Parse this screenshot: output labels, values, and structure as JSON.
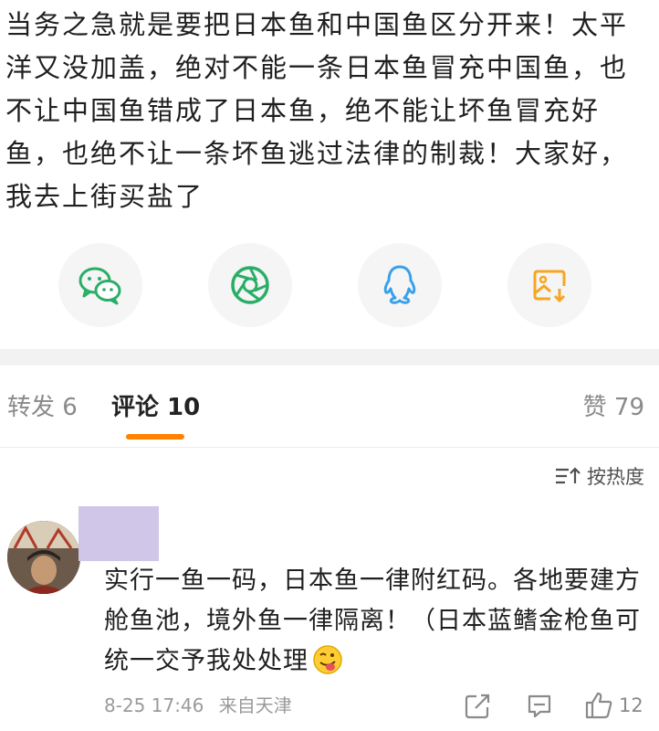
{
  "post": {
    "text": "当务之急就是要把日本鱼和中国鱼区分开来！太平洋又没加盖，绝对不能一条日本鱼冒充中国鱼，也不让中国鱼错成了日本鱼，绝不能让坏鱼冒充好鱼，也绝不让一条坏鱼逃过法律的制裁！大家好，我去上街买盐了"
  },
  "share": {
    "items": [
      {
        "icon": "wechat-icon",
        "color": "#2aae67"
      },
      {
        "icon": "moments-icon",
        "color": "#2aae67"
      },
      {
        "icon": "qq-icon",
        "color": "#3aa0e8"
      },
      {
        "icon": "save-image-icon",
        "color": "#f5a623"
      }
    ]
  },
  "tabs": {
    "repost_label": "转发 6",
    "comment_label": "评论 10",
    "like_label": "赞 79",
    "accent": "#ff8200"
  },
  "sort": {
    "label": "按热度"
  },
  "comment": {
    "text": "实行一鱼一码，日本鱼一律附红码。各地要建方舱鱼池，境外鱼一律隔离！（日本蓝鳍金枪鱼可统一交予我处处理",
    "emoji": "tongue-out-emoji",
    "date": "8-25 17:46",
    "source": "来自天津",
    "like_count": "12"
  }
}
